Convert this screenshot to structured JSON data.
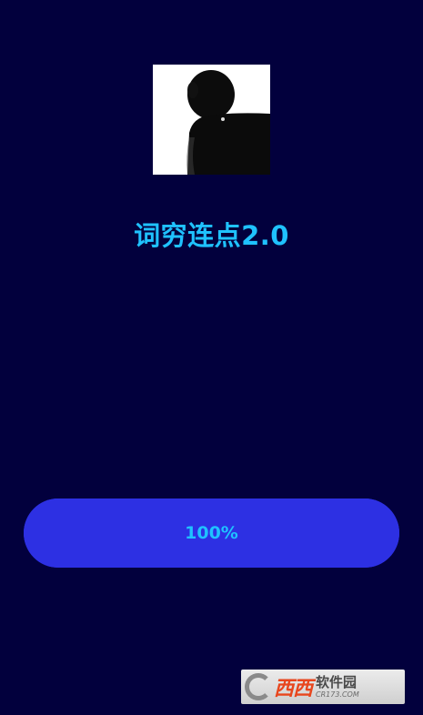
{
  "app": {
    "title": "词穷连点2.0",
    "logo_icon": "silhouette-avatar-icon"
  },
  "progress": {
    "label": "100%",
    "value": 1.0
  },
  "watermark": {
    "brand": "西西",
    "name": "软件园",
    "url": "CR173.COM"
  },
  "colors": {
    "background": "#02003d",
    "accent_text": "#1fc2ff",
    "progress_bar": "#2d30e3"
  }
}
